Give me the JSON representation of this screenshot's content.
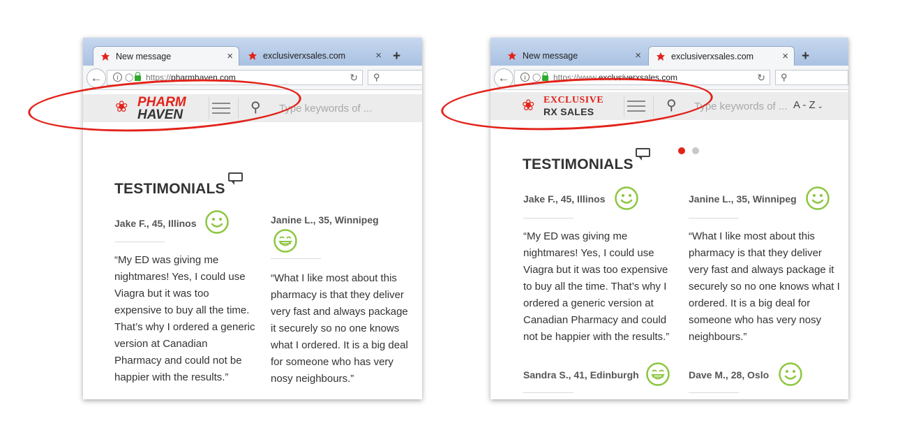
{
  "left": {
    "tabs": [
      {
        "title": "New message",
        "close": "×",
        "active": true
      },
      {
        "title": "exclusiverxsales.com",
        "close": "×",
        "active": false
      }
    ],
    "newtab": "+",
    "url_scheme": "https://",
    "url_host": "pharmhaven.com",
    "logo_line1": "PHARM",
    "logo_line2": "HAVEN",
    "search_placeholder": "Type keywords of ...",
    "heading": "TESTIMONIALS",
    "testimonials": [
      {
        "name": "Jake F., 45, Illinos",
        "quote": "“My ED was giving me nightmares! Yes, I could use Viagra but it was too expensive to buy all the time. That’s why I ordered a generic version at Canadian Pharmacy and could not be happier with the results.”"
      },
      {
        "name": "Janine L., 35, Winnipeg",
        "quote": "“What I like most about this pharmacy is that they deliver very fast and always package it securely so no one knows what I ordered. It is a big deal for someone who has very nosy neighbours.”"
      }
    ]
  },
  "right": {
    "tabs": [
      {
        "title": "New message",
        "close": "×",
        "active": false
      },
      {
        "title": "exclusiverxsales.com",
        "close": "×",
        "active": true
      }
    ],
    "newtab": "+",
    "url_scheme": "https://www.",
    "url_host": "exclusiverxsales.com",
    "logo_line1": "EXCLUSIVE",
    "logo_line2": "RX SALES",
    "search_placeholder": "Type keywords of ...",
    "az_label": "A - Z",
    "heading": "TESTIMONIALS",
    "testimonials": [
      {
        "name": "Jake F., 45, Illinos",
        "quote": "“My ED was giving me nightmares! Yes, I could use Viagra but it was too expensive to buy all the time. That’s why I ordered a generic version at Canadian Pharmacy and could not be happier with the results.”"
      },
      {
        "name": "Janine L., 35, Winnipeg",
        "quote": "“What I like most about this pharmacy is that they deliver very fast and always package it securely so no one knows what I ordered. It is a big deal for someone who has very nosy neighbours.”"
      },
      {
        "name": "Sandra S., 41, Edinburgh",
        "quote": ""
      },
      {
        "name": "Dave M., 28, Oslo",
        "quote": ""
      }
    ],
    "carousel_active_index": 0,
    "carousel_count": 2
  },
  "colors": {
    "brand_red": "#e2231a",
    "smiley_green": "#8cc63f",
    "tab_blue": "#a9c1e2"
  },
  "icons": [
    "favicon-icon",
    "close-icon",
    "plus-icon",
    "back-arrow-icon",
    "info-icon",
    "shield-icon",
    "lock-icon",
    "reload-icon",
    "search-icon",
    "hamburger-icon",
    "chevron-down-icon",
    "speech-bubble-icon",
    "smiley-icon",
    "grin-icon",
    "maple-leaf-icon"
  ]
}
